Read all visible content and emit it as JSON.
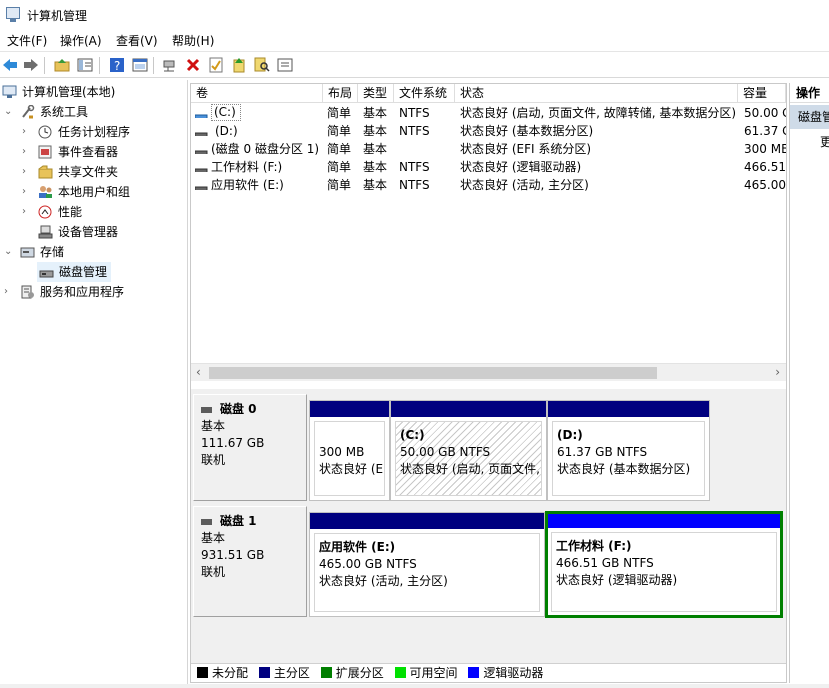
{
  "window": {
    "title": "计算机管理"
  },
  "menu": [
    "文件(F)",
    "操作(A)",
    "查看(V)",
    "帮助(H)"
  ],
  "toolbar_icons": [
    "back-arrow-icon",
    "forward-arrow-icon",
    "up-folder-icon",
    "show-hide-tree-icon",
    "help-icon",
    "view-icon",
    "connect-icon",
    "delete-icon",
    "properties-icon",
    "refresh-icon",
    "search-icon",
    "list-icon"
  ],
  "tree": {
    "root": "计算机管理(本地)",
    "system_tools": "系统工具",
    "task_scheduler": "任务计划程序",
    "event_viewer": "事件查看器",
    "shared_folders": "共享文件夹",
    "local_users": "本地用户和组",
    "performance": "性能",
    "device_manager": "设备管理器",
    "storage": "存储",
    "disk_management": "磁盘管理",
    "services": "服务和应用程序"
  },
  "columns": {
    "volume": "卷",
    "layout": "布局",
    "type": "类型",
    "fs": "文件系统",
    "status": "状态",
    "capacity": "容量"
  },
  "volumes": [
    {
      "name": "(C:)",
      "layout": "简单",
      "type": "基本",
      "fs": "NTFS",
      "status": "状态良好 (启动, 页面文件, 故障转储, 基本数据分区)",
      "capacity": "50.00 G"
    },
    {
      "name": "(D:)",
      "layout": "简单",
      "type": "基本",
      "fs": "NTFS",
      "status": "状态良好 (基本数据分区)",
      "capacity": "61.37 G"
    },
    {
      "name": "(磁盘 0 磁盘分区 1)",
      "layout": "简单",
      "type": "基本",
      "fs": "",
      "status": "状态良好 (EFI 系统分区)",
      "capacity": "300 MB"
    },
    {
      "name": "工作材料 (F:)",
      "layout": "简单",
      "type": "基本",
      "fs": "NTFS",
      "status": "状态良好 (逻辑驱动器)",
      "capacity": "466.51"
    },
    {
      "name": "应用软件 (E:)",
      "layout": "简单",
      "type": "基本",
      "fs": "NTFS",
      "status": "状态良好 (活动, 主分区)",
      "capacity": "465.00"
    }
  ],
  "disks": [
    {
      "name": "磁盘 0",
      "type": "基本",
      "size": "111.67 GB",
      "state": "联机",
      "partitions": [
        {
          "title": "",
          "size": "300 MB",
          "status": "状态良好 (EFI 系统分区)"
        },
        {
          "title": "(C:)",
          "size": "50.00 GB NTFS",
          "status": "状态良好 (启动, 页面文件, 故障转储, 基本数据分区)"
        },
        {
          "title": "(D:)",
          "size": "61.37 GB NTFS",
          "status": "状态良好 (基本数据分区)"
        }
      ]
    },
    {
      "name": "磁盘 1",
      "type": "基本",
      "size": "931.51 GB",
      "state": "联机",
      "partitions": [
        {
          "title": "应用软件  (E:)",
          "size": "465.00 GB NTFS",
          "status": "状态良好 (活动, 主分区)"
        },
        {
          "title": "工作材料  (F:)",
          "size": "466.51 GB NTFS",
          "status": "状态良好 (逻辑驱动器)"
        }
      ]
    }
  ],
  "legend": [
    {
      "label": "未分配",
      "color": "#000000"
    },
    {
      "label": "主分区",
      "color": "#000080"
    },
    {
      "label": "扩展分区",
      "color": "#007f00"
    },
    {
      "label": "可用空间",
      "color": "#00e000"
    },
    {
      "label": "逻辑驱动器",
      "color": "#0000ff"
    }
  ],
  "actions": {
    "title": "操作",
    "item": "磁盘管",
    "more": "更"
  },
  "colors": {
    "primary": "#00007f",
    "logical": "#0000ff",
    "extended": "#008000",
    "selected": "#cce8ff"
  }
}
